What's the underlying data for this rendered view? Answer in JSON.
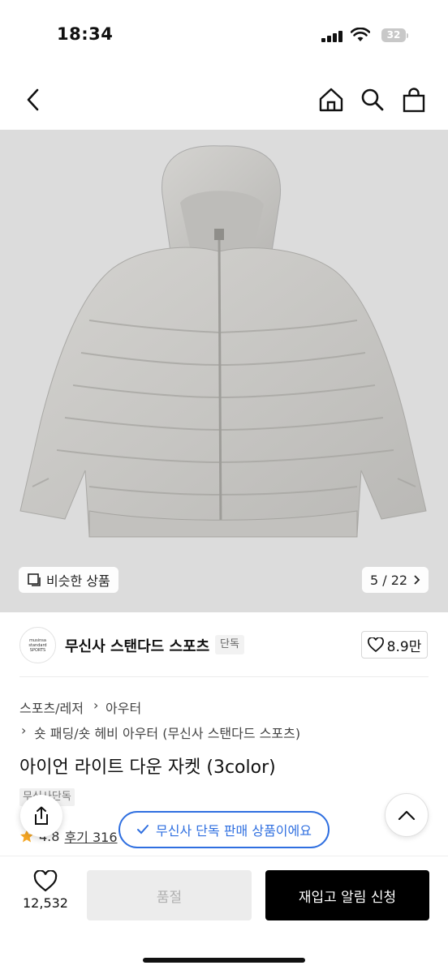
{
  "status_bar": {
    "time": "18:34",
    "battery": "32"
  },
  "nav": {
    "back_icon": "chevron-left-icon",
    "home_icon": "home-icon",
    "search_icon": "search-icon",
    "cart_icon": "shopping-bag-icon"
  },
  "gallery": {
    "similar_label": "비슷한 상품",
    "counter": "5 / 22"
  },
  "brand": {
    "logo_lines": [
      "musinsa",
      "standard",
      "SPORTS"
    ],
    "name": "무신사 스탠다드 스포츠",
    "badge": "단독"
  },
  "likes": {
    "count": "8.9만"
  },
  "breadcrumb": {
    "line1_a": "스포츠/레저",
    "line1_b": "아우터",
    "line2": "숏 패딩/숏 헤비 아우터 (무신사 스탠다드 스포츠)"
  },
  "product": {
    "title": "아이언 라이트 다운 자켓 (3color)",
    "exclusive_badge": "무신사단독",
    "rating": "4.8",
    "reviews": "후기 316"
  },
  "toast": {
    "text": "무신사 단독 판매 상품이에요"
  },
  "bottom_bar": {
    "wish_count": "12,532",
    "soldout_label": "품절",
    "restock_label": "재입고 알림 신청"
  },
  "colors": {
    "accent_blue": "#2f6fe0",
    "star": "#f5a623"
  }
}
